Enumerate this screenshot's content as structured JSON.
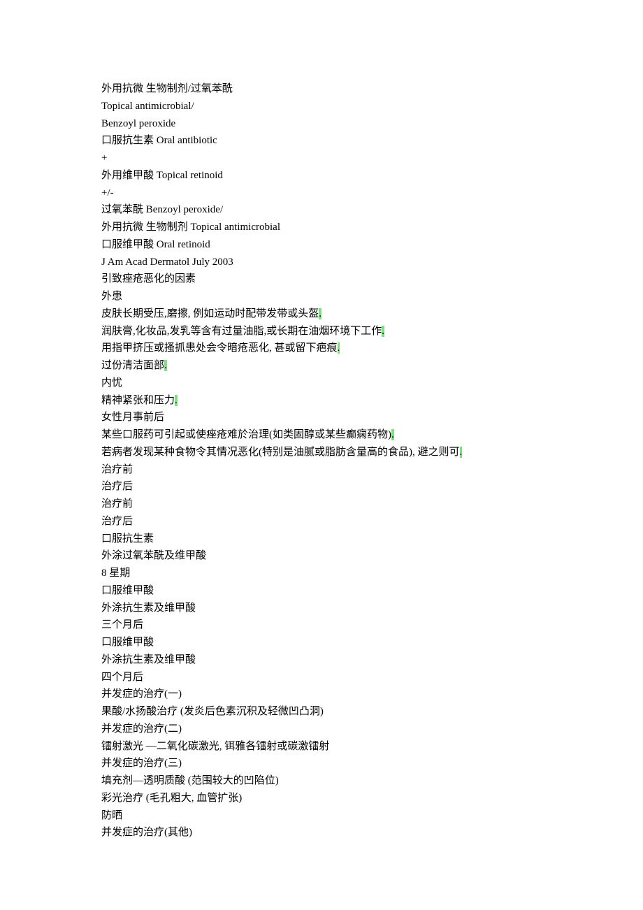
{
  "lines": [
    {
      "text": "外用抗微 生物制剂/过氧苯酰"
    },
    {
      "text": "Topical antimicrobial/"
    },
    {
      "text": "Benzoyl peroxide"
    },
    {
      "text": "口服抗生素 Oral antibiotic"
    },
    {
      "text": "+"
    },
    {
      "text": "外用维甲酸 Topical retinoid"
    },
    {
      "text": "+/-"
    },
    {
      "text": "过氧苯酰 Benzoyl peroxide/"
    },
    {
      "text": "外用抗微 生物制剂 Topical antimicrobial"
    },
    {
      "text": "口服维甲酸 Oral retinoid"
    },
    {
      "text": "J Am Acad Dermatol July 2003"
    },
    {
      "text": "引致痤疮恶化的因素"
    },
    {
      "text": "外患"
    },
    {
      "text": "皮肤长期受压,磨擦, 例如运动时配带发带或头盔",
      "hl": "."
    },
    {
      "text": "润肤膏,化妆品,发乳等含有过量油脂,或长期在油烟环境下工作",
      "hl": "."
    },
    {
      "text": "用指甲挤压或搔抓患处会令暗疮恶化, 甚或留下疤痕",
      "hl": "."
    },
    {
      "text": "过份清洁面部",
      "hl": "."
    },
    {
      "text": "内忧"
    },
    {
      "text": "精神紧张和压力",
      "hl": "."
    },
    {
      "text": "女性月事前后"
    },
    {
      "text": "某些口服药可引起或使痤疮难於治理(如类固醇或某些癫痫药物)",
      "hl": "."
    },
    {
      "text": "若病者发现某种食物令其情况恶化(特别是油腻或脂肪含量高的食品), 避之则可",
      "hl": "."
    },
    {
      "text": "治疗前"
    },
    {
      "text": "治疗后"
    },
    {
      "text": "治疗前"
    },
    {
      "text": "治疗后"
    },
    {
      "text": "口服抗生素"
    },
    {
      "text": "外涂过氧苯酰及维甲酸"
    },
    {
      "text": "8 星期"
    },
    {
      "text": "口服维甲酸"
    },
    {
      "text": "外涂抗生素及维甲酸"
    },
    {
      "text": "三个月后"
    },
    {
      "text": "口服维甲酸"
    },
    {
      "text": "外涂抗生素及维甲酸"
    },
    {
      "text": "四个月后"
    },
    {
      "text": "并发症的治疗(一)"
    },
    {
      "text": "果酸/水扬酸治疗 (发炎后色素沉积及轻微凹凸洞)"
    },
    {
      "text": "并发症的治疗(二)"
    },
    {
      "text": "镭射激光 —二氧化碳激光, 铒雅各镭射或碳激镭射"
    },
    {
      "text": "并发症的治疗(三)"
    },
    {
      "text": "填充剂—透明质酸 (范围较大的凹陷位)"
    },
    {
      "text": "彩光治疗 (毛孔粗大, 血管扩张)"
    },
    {
      "text": "防晒"
    },
    {
      "text": "并发症的治疗(其他)"
    }
  ]
}
